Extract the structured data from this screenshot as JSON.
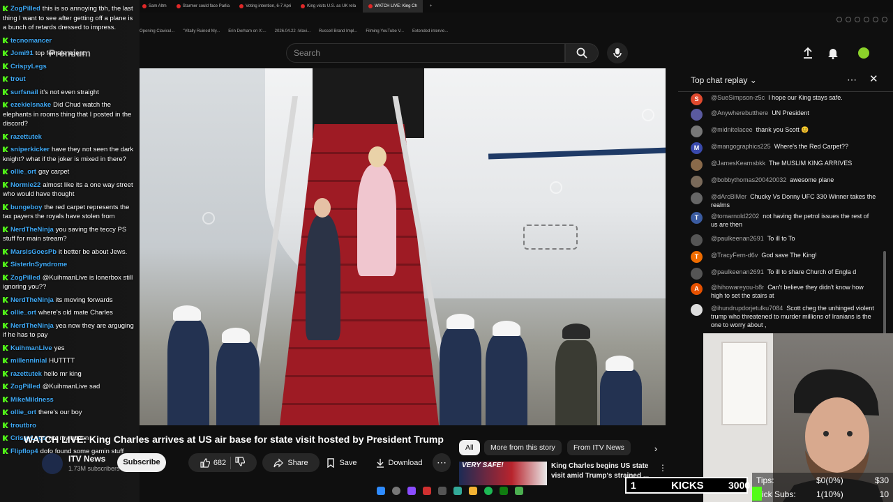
{
  "browser": {
    "tabs": [
      {
        "label": "Sam Altm"
      },
      {
        "label": "Starmer could face Parlia"
      },
      {
        "label": "Voting intention, 6-7 Apri"
      },
      {
        "label": "King visits U.S. as UK rela"
      },
      {
        "label": "WATCH LIVE: King Ch",
        "active": true
      }
    ],
    "bookmarks": [
      "Opening Clavicul...",
      "\"Vitally Ruined My...",
      "Erin Derham on X:...",
      "2026.04.22 -Mavi...",
      "Russell Brand Impl...",
      "Filming YouTube V...",
      "Extended intervie..."
    ]
  },
  "youtube": {
    "search_placeholder": "Search",
    "video_title": "WATCH LIVE: King Charles arrives at US air base for state visit hosted by President Trump",
    "channel_name": "ITV News",
    "subscribers": "1.73M subscribers",
    "subscribe_label": "Subscribe",
    "like_count": "682",
    "share_label": "Share",
    "save_label": "Save",
    "download_label": "Download",
    "chips": [
      "All",
      "More from this story",
      "From ITV News"
    ],
    "suggested": {
      "thumb_text": "VERY SAFE!",
      "title": "King Charles begins US state visit amid Trump's strained ..."
    },
    "watermark": "ITV NEWS"
  },
  "kick_chat": {
    "premium_label": "Premium",
    "messages": [
      {
        "user": "ZogPilled",
        "text": "this is so annoying tbh, the last thing I want to see after getting off a plane is a bunch of retards dressed to impress.",
        "color": "#3fa9f5"
      },
      {
        "user": "tecnomancer",
        "text": "",
        "color": "#3fa9f5"
      },
      {
        "user": "Jomi91",
        "text": "top female agent",
        "color": "#3fa9f5"
      },
      {
        "user": "CrispyLegs",
        "text": "",
        "color": "#3fa9f5"
      },
      {
        "user": "trout",
        "text": "",
        "color": "#3fa9f5"
      },
      {
        "user": "surfsnail",
        "text": "it's not even straight",
        "color": "#3fa9f5"
      },
      {
        "user": "ezekielsnake",
        "text": "Did Chud watch the elephants in rooms thing that I posted in the discord?",
        "color": "#3fa9f5"
      },
      {
        "user": "razettutek",
        "text": "",
        "color": "#3fa9f5"
      },
      {
        "user": "sniperkicker",
        "text": "have they not seen the dark knight? what if the joker is mixed in there?",
        "color": "#3fa9f5"
      },
      {
        "user": "ollie_ort",
        "text": "gay carpet",
        "color": "#3fa9f5"
      },
      {
        "user": "Normie22",
        "text": "almost like its a one way street who would have thought",
        "color": "#3fa9f5"
      },
      {
        "user": "bungeboy",
        "text": "the red carpet represents the tax payers the royals have stolen from",
        "color": "#3fa9f5"
      },
      {
        "user": "NerdTheNinja",
        "text": "you saving the teccy PS stuff for main stream?",
        "color": "#3fa9f5"
      },
      {
        "user": "MarsIsGoesPb",
        "text": "it better be about Jews.",
        "color": "#3fa9f5"
      },
      {
        "user": "SisterInSyndrome",
        "text": "",
        "color": "#3fa9f5"
      },
      {
        "user": "ZogPilled",
        "text": "@KuihmanLive is lonerbox still ignoring you??",
        "color": "#3fa9f5"
      },
      {
        "user": "NerdTheNinja",
        "text": "its moving forwards",
        "color": "#3fa9f5"
      },
      {
        "user": "ollie_ort",
        "text": "where's old mate Charles",
        "color": "#3fa9f5"
      },
      {
        "user": "NerdTheNinja",
        "text": "yea now they are arguging if he has to pay",
        "color": "#3fa9f5"
      },
      {
        "user": "KuihmanLive",
        "text": "yes",
        "color": "#3fa9f5"
      },
      {
        "user": "millenninial",
        "text": "HUTTTT",
        "color": "#3fa9f5"
      },
      {
        "user": "razettutek",
        "text": "hello mr king",
        "color": "#3fa9f5"
      },
      {
        "user": "ZogPilled",
        "text": "@KuihmanLive sad",
        "color": "#3fa9f5"
      },
      {
        "user": "MikeMildness",
        "text": "",
        "color": "#3fa9f5"
      },
      {
        "user": "ollie_ort",
        "text": "there's our boy",
        "color": "#3fa9f5"
      },
      {
        "user": "troutbro",
        "text": "",
        "color": "#3fa9f5"
      },
      {
        "user": "CrispyLegs",
        "text": "not my queen",
        "color": "#3fa9f5"
      },
      {
        "user": "Flipflop4",
        "text": "dofo found some gamin stuff",
        "color": "#3fa9f5"
      }
    ]
  },
  "live_chat": {
    "title": "Top chat replay",
    "messages": [
      {
        "author": "@SueSimpson-z5c",
        "text": "I hope our King stays safe.",
        "initial": "S",
        "color": "#e04a2f"
      },
      {
        "author": "@Anywherebutthere",
        "text": "UN President",
        "initial": "",
        "color": "#5a5aa0"
      },
      {
        "author": "@midnitelacee",
        "text": "thank you Scott 😊",
        "initial": "",
        "color": "#777"
      },
      {
        "author": "@mangographics225",
        "text": "Where's the Red Carpet??",
        "initial": "M",
        "color": "#3949ab"
      },
      {
        "author": "@JamesKearnsbkk",
        "text": "The MUSLIM KING ARRIVES",
        "initial": "",
        "color": "#8a6a4a"
      },
      {
        "author": "@bobbythomas200420032",
        "text": "awesome plane",
        "initial": "",
        "color": "#7a6a5a"
      },
      {
        "author": "@dArcBlMer",
        "text": "Chucky Vs Donny UFC 330 Winner takes the realms",
        "initial": "",
        "color": "#666"
      },
      {
        "author": "@tomarnold2202",
        "text": "not having the petrol issues the rest of us are then",
        "initial": "T",
        "color": "#3a5ba0"
      },
      {
        "author": "@paulkeenan2691",
        "text": "To ill to To",
        "initial": "",
        "color": "#555"
      },
      {
        "author": "@TracyFern-d6v",
        "text": "God save The King!",
        "initial": "T",
        "color": "#ef6c00"
      },
      {
        "author": "@paulkeenan2691",
        "text": "To ill to share Church of Engla d",
        "initial": "",
        "color": "#555"
      },
      {
        "author": "@hihowareyou-b8r",
        "text": "Can't believe they didn't know how high to set the stairs at",
        "initial": "A",
        "color": "#e65100"
      },
      {
        "author": "@ihundrupdorjetulku7084",
        "text": "Scott cheg the unhinged violent trump who threatened to murder millions of Iranians is the one to worry about ,",
        "initial": "",
        "color": "#ddd"
      }
    ]
  },
  "kick_stats": {
    "kicks_count": "1",
    "kicks_label": "KICKS",
    "kicks_goal": "3000",
    "tips_label": "Tips:",
    "tips_value": "$0(0%)",
    "tips_goal": "$30",
    "subs_label": "Kick Subs:",
    "subs_value": "1(10%)",
    "subs_goal": "10"
  }
}
